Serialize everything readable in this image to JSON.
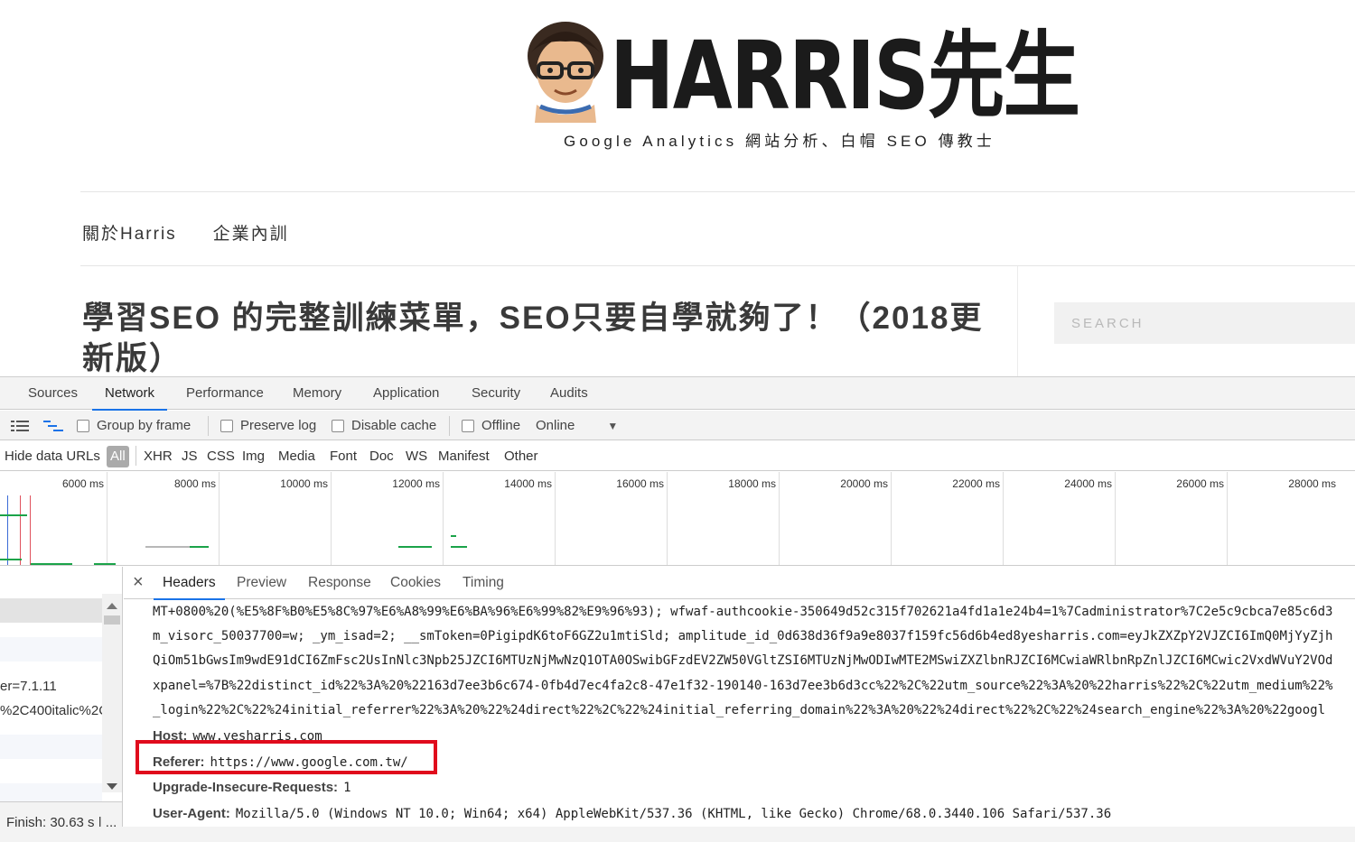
{
  "site": {
    "logo_text": "HARRIS先生",
    "tagline": "Google Analytics 網站分析、白帽 SEO 傳教士",
    "menu": [
      "關於Harris",
      "企業內訓"
    ],
    "post_title": "學習SEO 的完整訓練菜單，SEO只要自學就夠了！（2018更新版）",
    "search_placeholder": "SEARCH"
  },
  "devtools": {
    "panels": [
      "Sources",
      "Network",
      "Performance",
      "Memory",
      "Application",
      "Security",
      "Audits"
    ],
    "active_panel": "Network",
    "toolbar": {
      "group_by_frame": "Group by frame",
      "preserve_log": "Preserve log",
      "disable_cache": "Disable cache",
      "offline": "Offline",
      "throttle": "Online"
    },
    "filter": {
      "hide_data_urls": "Hide data URLs",
      "types": [
        "All",
        "XHR",
        "JS",
        "CSS",
        "Img",
        "Media",
        "Font",
        "Doc",
        "WS",
        "Manifest",
        "Other"
      ]
    },
    "timeline_ticks": [
      "6000 ms",
      "8000 ms",
      "10000 ms",
      "12000 ms",
      "14000 ms",
      "16000 ms",
      "18000 ms",
      "20000 ms",
      "22000 ms",
      "24000 ms",
      "26000 ms",
      "28000 ms"
    ],
    "request_list": {
      "rows": [
        "",
        "",
        "",
        "er=7.1.11",
        "%2C400italic%2C",
        "",
        "",
        ""
      ],
      "status": "Finish: 30.63 s  |  ..."
    },
    "detail_tabs": [
      "Headers",
      "Preview",
      "Response",
      "Cookies",
      "Timing"
    ],
    "active_detail_tab": "Headers",
    "close_glyph": "×",
    "cookie_lines": [
      "MT+0800%20(%E5%8F%B0%E5%8C%97%E6%A8%99%E6%BA%96%E6%99%82%E9%96%93); wfwaf-authcookie-350649d52c315f702621a4fd1a1e24b4=1%7Cadministrator%7C2e5c9cbca7e85c6d3",
      "m_visorc_50037700=w; _ym_isad=2; __smToken=0PigipdK6toF6GZ2u1mtiSld; amplitude_id_0d638d36f9a9e8037f159fc56d6b4ed8yesharris.com=eyJkZXZpY2VJZCI6ImQ0MjYyZjh",
      "QiOm51bGwsIm9wdE91dCI6ZmFsc2UsInNlc3Npb25JZCI6MTUzNjMwNzQ1OTA0OSwibGFzdEV2ZW50VGltZSI6MTUzNjMwODIwMTE2MSwiZXZlbnRJZCI6MCwiaWRlbnRpZnlJZCI6MCwic2VxdWVuY2VOd",
      "xpanel=%7B%22distinct_id%22%3A%20%22163d7ee3b6c674-0fb4d7ec4fa2c8-47e1f32-190140-163d7ee3b6d3cc%22%2C%22utm_source%22%3A%20%22harris%22%2C%22utm_medium%22%",
      "_login%22%2C%22%24initial_referrer%22%3A%20%22%24direct%22%2C%22%24initial_referring_domain%22%3A%20%22%24direct%22%2C%22%24search_engine%22%3A%20%22googl"
    ],
    "headers": [
      {
        "key": "Host:",
        "value": "www.yesharris.com"
      },
      {
        "key": "Referer:",
        "value": "https://www.google.com.tw/"
      },
      {
        "key": "Upgrade-Insecure-Requests:",
        "value": "1"
      },
      {
        "key": "User-Agent:",
        "value": "Mozilla/5.0 (Windows NT 10.0; Win64; x64) AppleWebKit/537.36 (KHTML, like Gecko) Chrome/68.0.3440.106 Safari/537.36"
      }
    ],
    "highlight_color": "#e00b1c",
    "accent_color": "#1a73e8",
    "bar_color": "#1ba349"
  }
}
